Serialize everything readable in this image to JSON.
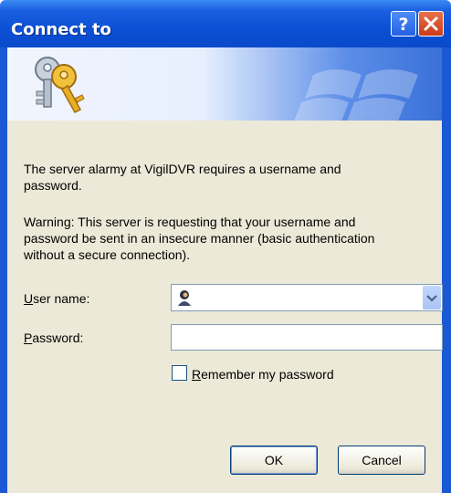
{
  "window": {
    "title": "Connect to",
    "help_icon": "question-mark-icon",
    "close_icon": "x-close-icon"
  },
  "banner": {
    "keys_icon": "keys-icon",
    "watermark": "windows-flag-watermark"
  },
  "message": {
    "line1": "The server alarmy at VigilDVR requires a username and",
    "line2": "password.",
    "warn1": "Warning: This server is requesting that your username and",
    "warn2": "password be sent in an insecure manner (basic authentication",
    "warn3": "without a secure connection)."
  },
  "form": {
    "username_label_u": "U",
    "username_label_rest": "ser name:",
    "username_value": "",
    "password_label_u": "P",
    "password_label_rest": "assword:",
    "password_value": "",
    "remember_label_u": "R",
    "remember_label_rest": "emember my password",
    "remember_checked": false
  },
  "buttons": {
    "ok": "OK",
    "cancel": "Cancel"
  },
  "colors": {
    "titlebar": "#0a4fd4",
    "dialog_bg": "#ece9d8",
    "close_btn": "#c83c18"
  }
}
